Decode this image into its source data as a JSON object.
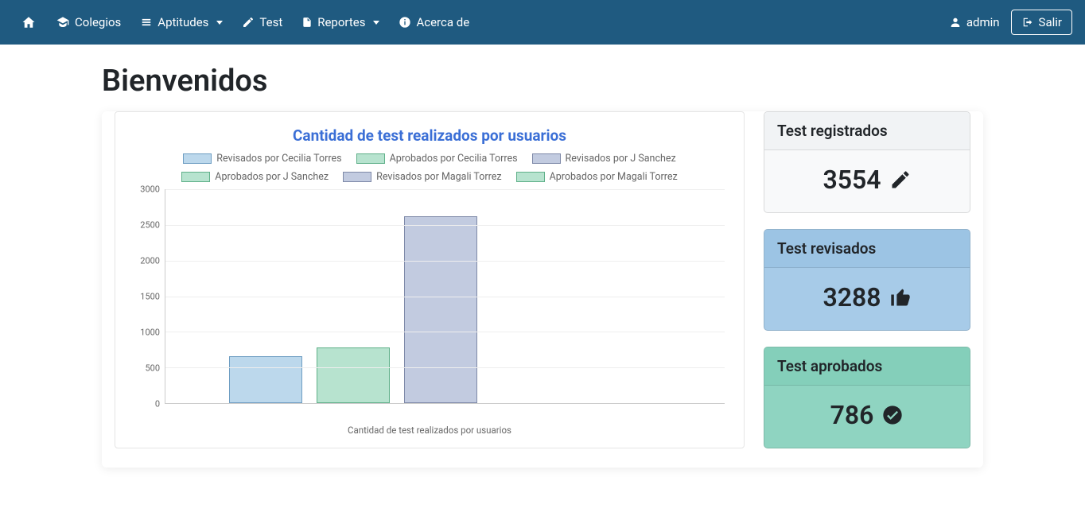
{
  "nav": {
    "home": "",
    "colegios": "Colegios",
    "aptitudes": "Aptitudes",
    "test": "Test",
    "reportes": "Reportes",
    "acerca": "Acerca de",
    "user": "admin",
    "salir": "Salir"
  },
  "page": {
    "title": "Bienvenidos"
  },
  "stats": {
    "registered": {
      "label": "Test registrados",
      "value": "3554"
    },
    "reviewed": {
      "label": "Test revisados",
      "value": "3288"
    },
    "approved": {
      "label": "Test aprobados",
      "value": "786"
    }
  },
  "chart_data": {
    "type": "bar",
    "title": "Cantidad de test realizados por usuarios",
    "xlabel": "Cantidad de test realizados por usuarios",
    "ylabel": "",
    "ylim": [
      0,
      3000
    ],
    "yticks": [
      0,
      500,
      1000,
      1500,
      2000,
      2500,
      3000
    ],
    "series": [
      {
        "name": "Revisados por Cecilia Torres",
        "color": "#bcd8ec",
        "border": "#6e9dc2",
        "value": 660
      },
      {
        "name": "Aprobados por Cecilia Torres",
        "color": "#b7e3cf",
        "border": "#5fb089",
        "value": 780
      },
      {
        "name": "Revisados por J Sanchez",
        "color": "#c2cbe0",
        "border": "#7e89a8",
        "value": 2620
      },
      {
        "name": "Aprobados por J Sanchez",
        "color": "#b7e3cf",
        "border": "#5fb089",
        "value": 0
      },
      {
        "name": "Revisados por Magali Torrez",
        "color": "#c2cbe0",
        "border": "#7e89a8",
        "value": 0
      },
      {
        "name": "Aprobados por Magali Torrez",
        "color": "#b7e3cf",
        "border": "#5fb089",
        "value": 0
      }
    ]
  }
}
